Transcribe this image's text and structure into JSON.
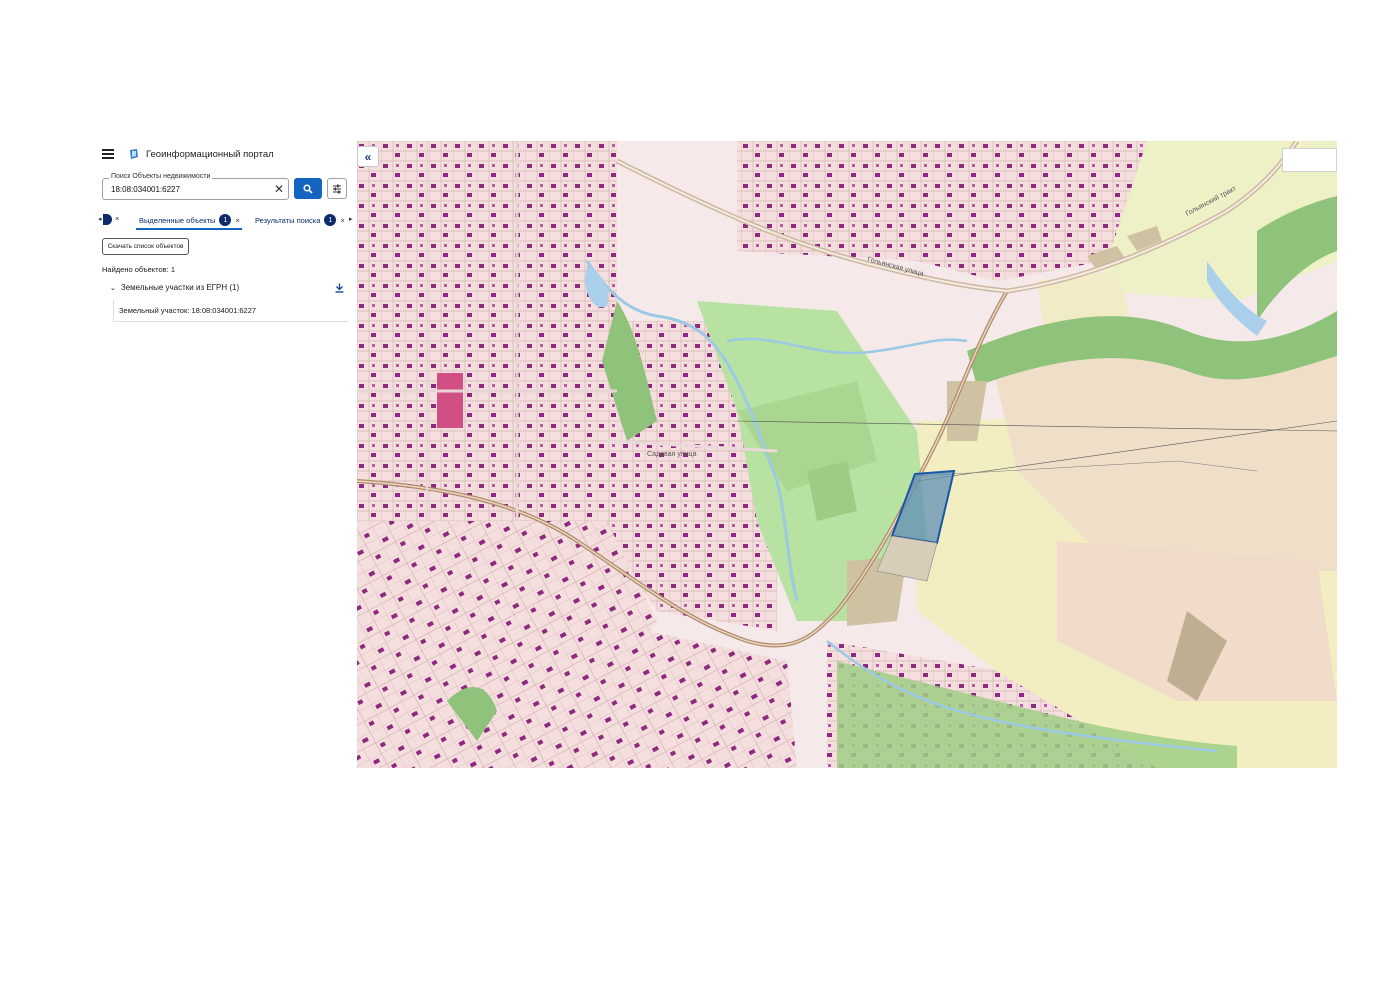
{
  "header": {
    "title": "Геоинформационный портал",
    "menu_icon": "menu-icon",
    "logo_icon": "globe-logo-icon"
  },
  "search": {
    "label": "Поиск Объекты недвижимости",
    "value": "18:08:034001:6227"
  },
  "tabs": [
    {
      "label": "Выделенные объекты",
      "count": "1"
    },
    {
      "label": "Результаты поиска",
      "count": "1"
    }
  ],
  "download_list_label": "Скачать список объектов",
  "found_text": "Найдено объектов: 1",
  "result_group": {
    "label": "Земельные участки из ЕГРН (1)",
    "items": [
      {
        "label": "Земельный участок: 18:08:034001:6227"
      }
    ]
  },
  "map": {
    "selected_parcel_color": "#1a56a8",
    "road_labels": [
      "Гольянская улица",
      "Гольянский тракт",
      "Садовая улица"
    ]
  },
  "colors": {
    "accent": "#1565c0",
    "badge": "#0d2a6b"
  }
}
